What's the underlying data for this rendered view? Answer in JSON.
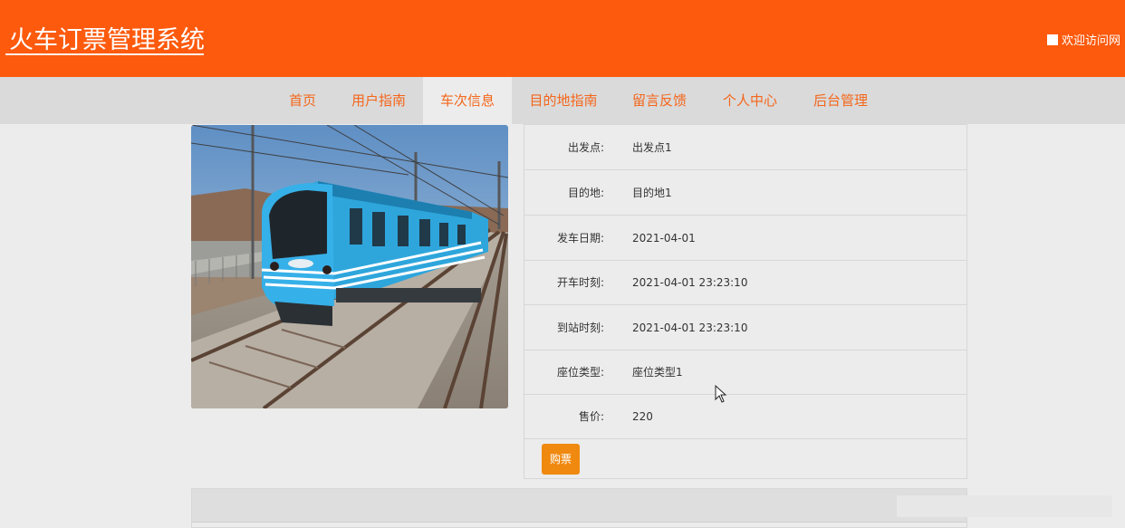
{
  "header": {
    "site_title": "火车订票管理系统",
    "welcome_text": "欢迎访问网",
    "bg_color": "#fd5a0d"
  },
  "nav": {
    "items": [
      {
        "label": "首页",
        "active": false
      },
      {
        "label": "用户指南",
        "active": false
      },
      {
        "label": "车次信息",
        "active": true
      },
      {
        "label": "目的地指南",
        "active": false
      },
      {
        "label": "留言反馈",
        "active": false
      },
      {
        "label": "个人中心",
        "active": false
      },
      {
        "label": "后台管理",
        "active": false
      }
    ],
    "text_color": "#f4661b"
  },
  "detail": {
    "rows": [
      {
        "label": "出发点:",
        "value": "出发点1"
      },
      {
        "label": "目的地:",
        "value": "目的地1"
      },
      {
        "label": "发车日期:",
        "value": "2021-04-01"
      },
      {
        "label": "开车时刻:",
        "value": "2021-04-01 23:23:10"
      },
      {
        "label": "到站时刻:",
        "value": "2021-04-01 23:23:10"
      },
      {
        "label": "座位类型:",
        "value": "座位类型1"
      },
      {
        "label": "售价:",
        "value": "220"
      }
    ],
    "buy_label": "购票",
    "buy_color": "#f0890f"
  }
}
